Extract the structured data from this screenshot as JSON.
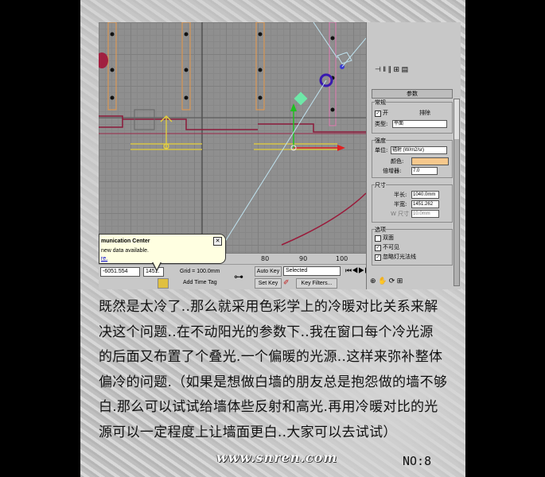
{
  "ruler_ticks": [
    "80",
    "90",
    "100"
  ],
  "balloon": {
    "title": "munication Center",
    "line1": "new data available.",
    "link": "re.",
    "close": "✕"
  },
  "status": {
    "coord_x": "-6051.554",
    "coord_y": "1451.",
    "grid": "Grid = 100.0mm",
    "add_time_tag": "Add Time Tag",
    "auto_key": "Auto Key",
    "set_key": "Set Key",
    "selected": "Selected",
    "key_filters": "Key Filters...",
    "frame": "0"
  },
  "panel": {
    "rollout": "参数",
    "general": "常规",
    "on": "开",
    "exclude": "排除",
    "type_label": "类型:",
    "type_value": "平面",
    "intensity": "强度",
    "unit_label": "单位:",
    "unit_value": "辐射 (W/m2/sr)",
    "color_label": "颜色:",
    "multiplier_label": "倍增器:",
    "multiplier_value": "7.0",
    "size": "尺寸",
    "half_length_label": "半长:",
    "half_length_value": "1040.0mm",
    "half_width_label": "半宽:",
    "half_width_value": "1451.262",
    "w_size_label": "W 尺寸",
    "w_size_value": "10.0mm",
    "options": "选项",
    "double_sided": "双面",
    "invisible": "不可见",
    "ignore_light": "忽略灯光法线",
    "color_hex": "#f6c88c"
  },
  "paragraph": [
    "既然是太冷了..那么就采用色彩学上的冷暖对比关系来解",
    "决这个问题..在不动阳光的参数下..我在窗口每个冷光源",
    "的后面又布置了个叠光.一个偏暖的光源..这样来弥补整体",
    "偏冷的问题.（如果是想做白墙的朋友总是抱怨做的墙不够",
    "白.那么可以试试给墙体些反射和高光.再用冷暖对比的光",
    "源可以一定程度上让墙面更白..大家可以去试试）"
  ],
  "site": "www.snren.com",
  "page_number": "NO:8"
}
